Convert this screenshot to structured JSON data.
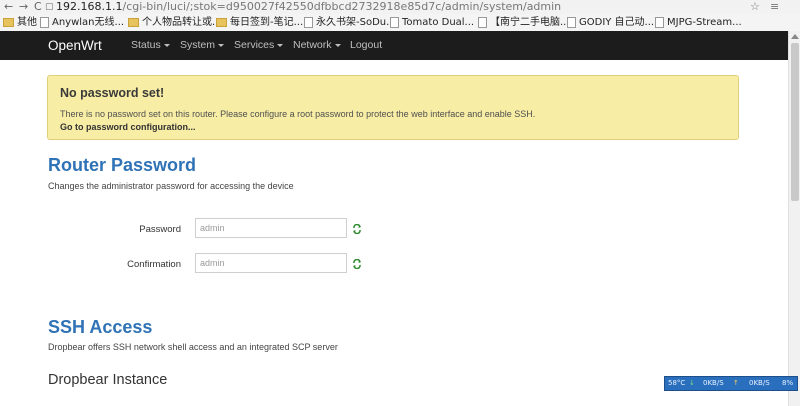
{
  "browser": {
    "url_host": "192.168.1.1",
    "url_rest": "/cgi-bin/luci/;stok=d950027f42550dfbbcd2732918e85d7c/admin/system/admin",
    "bookmarks": [
      {
        "label": "其他",
        "icon": "folder"
      },
      {
        "label": "Anywlan无线...",
        "icon": "page"
      },
      {
        "label": "个人物品转让或...",
        "icon": "folder"
      },
      {
        "label": "每日签到-笔记...",
        "icon": "folder"
      },
      {
        "label": "永久书架-SoDu...",
        "icon": "page"
      },
      {
        "label": "Tomato Dual...",
        "icon": "page"
      },
      {
        "label": "【南宁二手电脑...",
        "icon": "page"
      },
      {
        "label": "GODIY 自己动...",
        "icon": "page"
      },
      {
        "label": "MJPG-Stream...",
        "icon": "page"
      }
    ]
  },
  "header": {
    "brand": "OpenWrt",
    "menu": [
      "Status",
      "System",
      "Services",
      "Network",
      "Logout"
    ]
  },
  "alert": {
    "title": "No password set!",
    "text": "There is no password set on this router. Please configure a root password to protect the web interface and enable SSH.",
    "link": "Go to password configuration..."
  },
  "router_password": {
    "title": "Router Password",
    "desc": "Changes the administrator password for accessing the device",
    "password_label": "Password",
    "password_value": "admin",
    "confirmation_label": "Confirmation",
    "confirmation_value": "admin"
  },
  "ssh": {
    "title": "SSH Access",
    "desc": "Dropbear offers SSH network shell access and an integrated SCP server",
    "instance_title": "Dropbear Instance"
  },
  "netmon": {
    "temp": "58°C",
    "down": "0KB/S",
    "up": "0KB/S",
    "pct": "8%"
  }
}
